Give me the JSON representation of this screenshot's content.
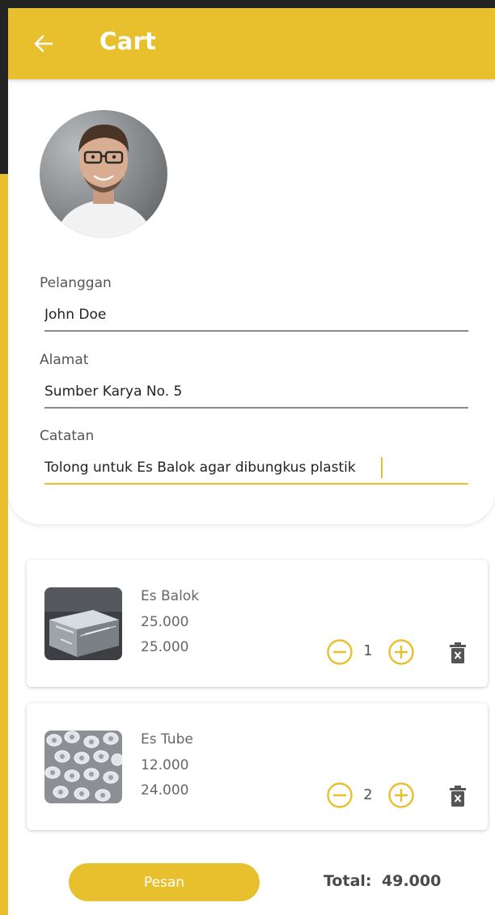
{
  "appbar": {
    "title": "Cart"
  },
  "form": {
    "customer_label": "Pelanggan",
    "customer_value": "John Doe",
    "address_label": "Alamat",
    "address_value": "Sumber Karya No. 5",
    "note_label": "Catatan",
    "note_value": "Tolong untuk Es Balok agar dibungkus plastik"
  },
  "items": [
    {
      "name": "Es Balok",
      "price": "25.000",
      "subtotal": "25.000",
      "qty": "1"
    },
    {
      "name": "Es Tube",
      "price": "12.000",
      "subtotal": "24.000",
      "qty": "2"
    }
  ],
  "footer": {
    "order_label": "Pesan",
    "total_label": "Total:",
    "total_value": "49.000"
  },
  "colors": {
    "accent": "#e8c02e",
    "background": "#242424"
  },
  "icons": {
    "back": "arrow-left-icon",
    "minus": "minus-circle-icon",
    "plus": "plus-circle-icon",
    "delete": "trash-icon"
  }
}
